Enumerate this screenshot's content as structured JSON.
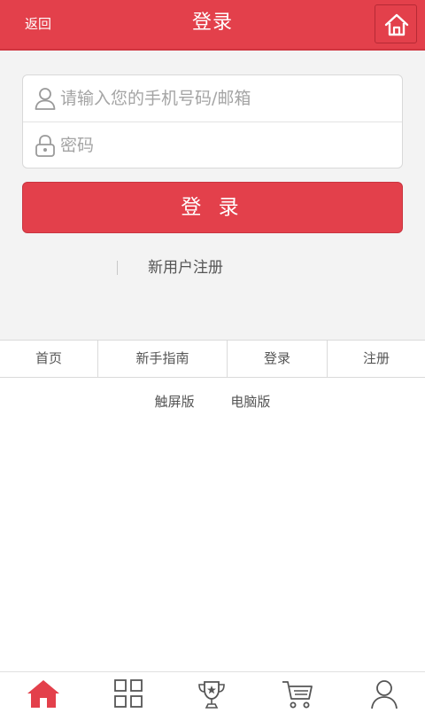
{
  "header": {
    "back_label": "返回",
    "title": "登录",
    "home_icon": "home-icon",
    "accent_color": "#e3404b"
  },
  "login_form": {
    "account": {
      "icon": "user-icon",
      "placeholder": "请输入您的手机号码/邮箱",
      "value": ""
    },
    "password": {
      "icon": "lock-icon",
      "placeholder": "密码",
      "value": ""
    },
    "submit_label": "登 录",
    "register_label": "新用户注册"
  },
  "footer_nav": {
    "items": [
      "首页",
      "新手指南",
      "登录",
      "注册"
    ]
  },
  "versions": {
    "touch": "触屏版",
    "desktop": "电脑版"
  },
  "tabbar": {
    "items": [
      {
        "icon": "home-icon",
        "active": true
      },
      {
        "icon": "category-grid-icon",
        "active": false
      },
      {
        "icon": "trophy-icon",
        "active": false
      },
      {
        "icon": "cart-icon",
        "active": false
      },
      {
        "icon": "profile-icon",
        "active": false
      }
    ]
  }
}
